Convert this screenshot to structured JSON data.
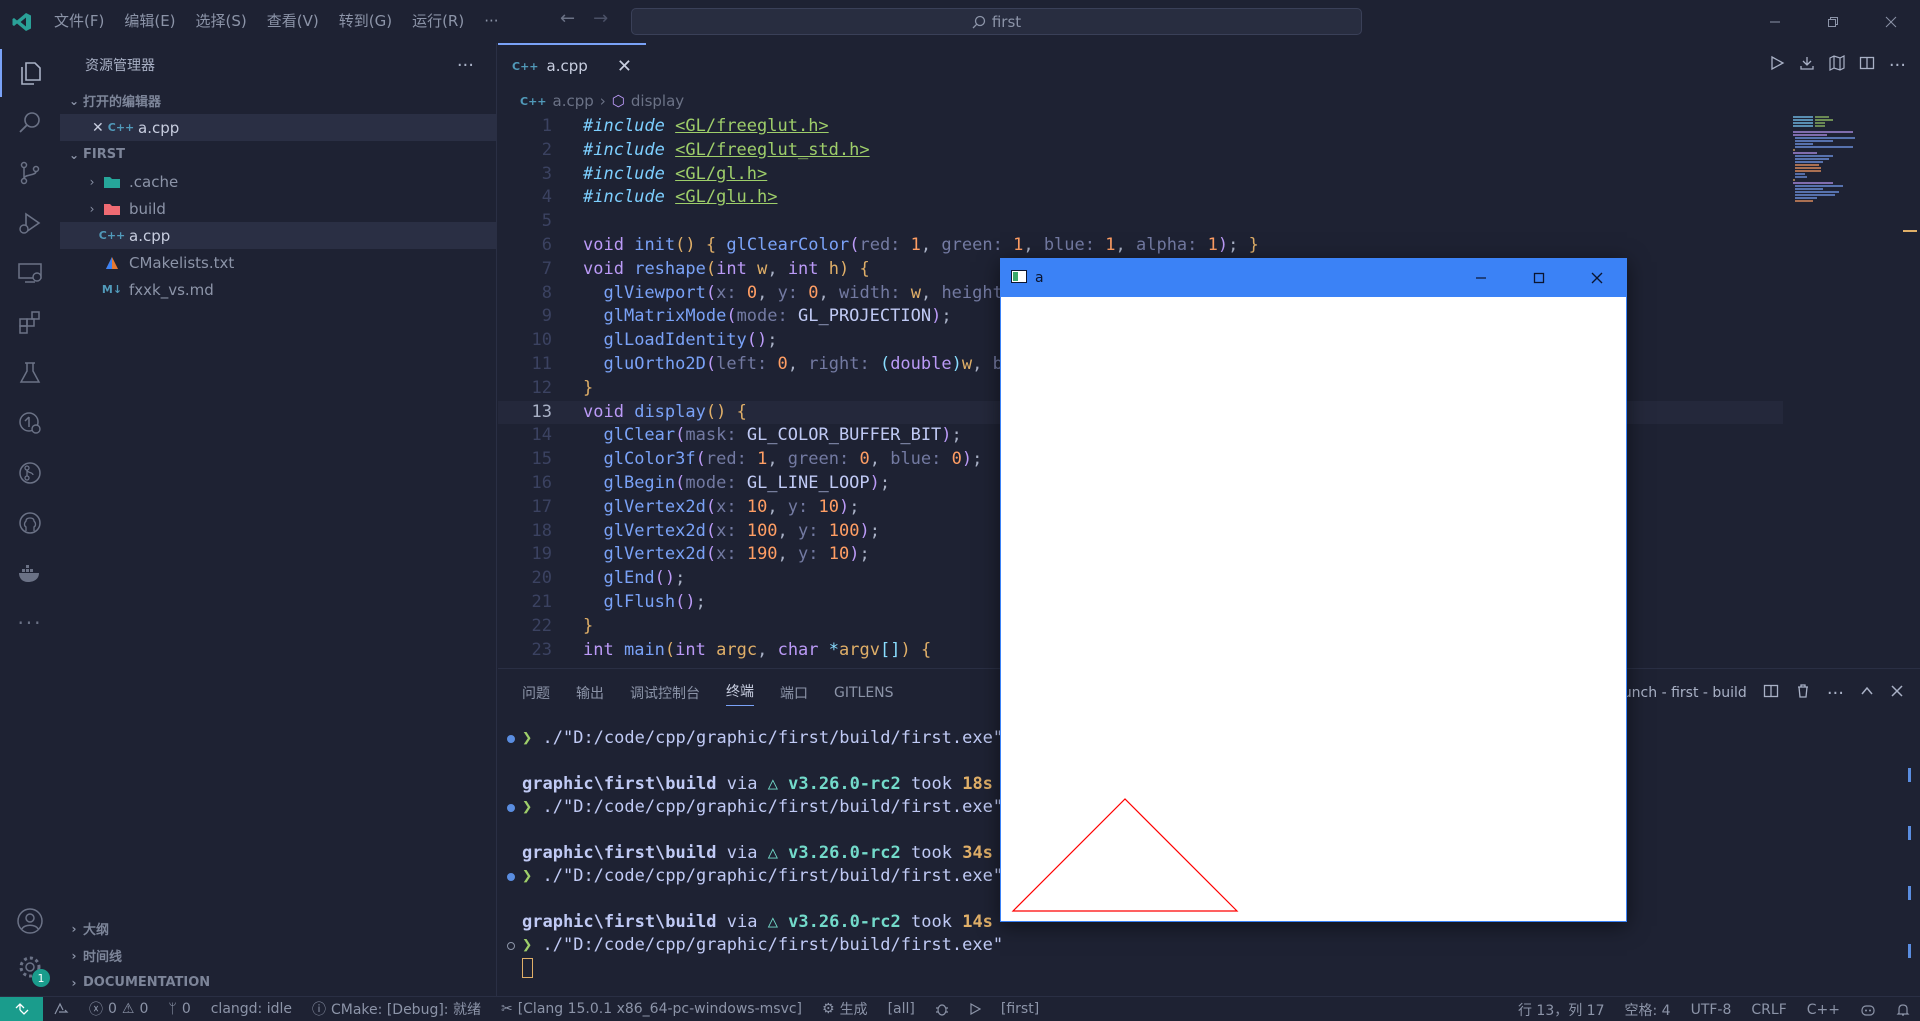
{
  "menus": [
    "文件(F)",
    "编辑(E)",
    "选择(S)",
    "查看(V)",
    "转到(G)",
    "运行(R)",
    "···"
  ],
  "search": {
    "text": "first"
  },
  "sidebar": {
    "title": "资源管理器",
    "open_editors_label": "打开的编辑器",
    "open_editors": [
      {
        "name": "a.cpp"
      }
    ],
    "folder_label": "FIRST",
    "tree": [
      {
        "name": ".cache",
        "type": "folder"
      },
      {
        "name": "build",
        "type": "folder"
      },
      {
        "name": "a.cpp",
        "type": "cpp"
      },
      {
        "name": "CMakelists.txt",
        "type": "cmake"
      },
      {
        "name": "fxxk_vs.md",
        "type": "md"
      }
    ],
    "bottom_sections": [
      "大纲",
      "时间线",
      "DOCUMENTATION"
    ]
  },
  "activity_badge": "1",
  "tab": {
    "label": "a.cpp",
    "icon_text": "C++"
  },
  "breadcrumb": {
    "file": "a.cpp",
    "symbol": "display"
  },
  "code": [
    {
      "n": 1,
      "html": "<span class='kw-inc'>#include</span> <span class='inc-path'>&lt;GL/freeglut.h&gt;</span>"
    },
    {
      "n": 2,
      "html": "<span class='kw-inc'>#include</span> <span class='inc-path'>&lt;GL/freeglut_std.h&gt;</span>"
    },
    {
      "n": 3,
      "html": "<span class='kw-inc'>#include</span> <span class='inc-path'>&lt;GL/gl.h&gt;</span>"
    },
    {
      "n": 4,
      "html": "<span class='kw-inc'>#include</span> <span class='inc-path'>&lt;GL/glu.h&gt;</span>"
    },
    {
      "n": 5,
      "html": ""
    },
    {
      "n": 6,
      "html": "<span class='kw'>void</span> <span class='fn'>init</span><span class='par'>()</span> <span class='par'>{</span> <span class='fn'>glClearColor</span><span class='kw'>(</span><span class='hint'>red:</span> <span class='num'>1</span>, <span class='hint'>green:</span> <span class='num'>1</span>, <span class='hint'>blue:</span> <span class='num'>1</span>, <span class='hint'>alpha:</span> <span class='num'>1</span><span class='kw'>)</span>; <span class='par'>}</span>"
    },
    {
      "n": 7,
      "html": "<span class='kw'>void</span> <span class='fn'>reshape</span><span class='par'>(</span><span class='kw'>int</span> <span class='prm'>w</span>, <span class='kw'>int</span> <span class='prm'>h</span><span class='par'>)</span> <span class='par'>{</span>"
    },
    {
      "n": 8,
      "html": "  <span class='fn'>glViewport</span><span class='kw'>(</span><span class='hint'>x:</span> <span class='num'>0</span>, <span class='hint'>y:</span> <span class='num'>0</span>, <span class='hint'>width:</span> <span class='prm'>w</span>, <span class='hint'>height</span>"
    },
    {
      "n": 9,
      "html": "  <span class='fn'>glMatrixMode</span><span class='kw'>(</span><span class='hint'>mode:</span> <span class='cst'>GL_PROJECTION</span><span class='kw'>)</span>;"
    },
    {
      "n": 10,
      "html": "  <span class='fn'>glLoadIdentity</span><span class='kw'>()</span>;"
    },
    {
      "n": 11,
      "html": "  <span class='fn'>gluOrtho2D</span><span class='kw'>(</span><span class='hint'>left:</span> <span class='num'>0</span>, <span class='hint'>right:</span> <span class='pun'>(</span><span class='kw'>double</span><span class='pun'>)</span><span class='prm'>w</span>, <span class='hint'>b</span>"
    },
    {
      "n": 12,
      "html": "<span class='par'>}</span>"
    },
    {
      "n": 13,
      "html": "<span class='kw'>void</span> <span class='fn'>display</span><span class='par'>()</span> <span class='par'>{</span>",
      "current": true
    },
    {
      "n": 14,
      "html": "  <span class='fn'>glClear</span><span class='kw'>(</span><span class='hint'>mask:</span> <span class='cst'>GL_COLOR_BUFFER_BIT</span><span class='kw'>)</span>;"
    },
    {
      "n": 15,
      "html": "  <span class='fn'>glColor3f</span><span class='kw'>(</span><span class='hint'>red:</span> <span class='num'>1</span>, <span class='hint'>green:</span> <span class='num'>0</span>, <span class='hint'>blue:</span> <span class='num'>0</span><span class='kw'>)</span>;"
    },
    {
      "n": 16,
      "html": "  <span class='fn'>glBegin</span><span class='kw'>(</span><span class='hint'>mode:</span> <span class='cst'>GL_LINE_LOOP</span><span class='kw'>)</span>;"
    },
    {
      "n": 17,
      "html": "  <span class='fn'>glVertex2d</span><span class='kw'>(</span><span class='hint'>x:</span> <span class='num'>10</span>, <span class='hint'>y:</span> <span class='num'>10</span><span class='kw'>)</span>;"
    },
    {
      "n": 18,
      "html": "  <span class='fn'>glVertex2d</span><span class='kw'>(</span><span class='hint'>x:</span> <span class='num'>100</span>, <span class='hint'>y:</span> <span class='num'>100</span><span class='kw'>)</span>;"
    },
    {
      "n": 19,
      "html": "  <span class='fn'>glVertex2d</span><span class='kw'>(</span><span class='hint'>x:</span> <span class='num'>190</span>, <span class='hint'>y:</span> <span class='num'>10</span><span class='kw'>)</span>;"
    },
    {
      "n": 20,
      "html": "  <span class='fn'>glEnd</span><span class='kw'>()</span>;"
    },
    {
      "n": 21,
      "html": "  <span class='fn'>glFlush</span><span class='kw'>()</span>;"
    },
    {
      "n": 22,
      "html": "<span class='par'>}</span>"
    },
    {
      "n": 23,
      "html": "<span class='kw'>int</span> <span class='fn'>main</span><span class='par'>(</span><span class='kw'>int</span> <span class='var'>argc</span>, <span class='kw'>char</span> <span class='pun'>*</span><span class='var'>argv</span><span class='pun'>[]</span><span class='par'>)</span> <span class='par'>{</span>"
    }
  ],
  "panel": {
    "tabs": [
      "问题",
      "输出",
      "调试控制台",
      "终端",
      "端口",
      "GITLENS"
    ],
    "active_tab": "终端",
    "terminal_name": "aunch - first - build"
  },
  "terminal": {
    "command": "./\"D:/code/cpp/graphic/first/build/first.exe\"",
    "prompt_char": "❯",
    "path": "graphic\\first\\build",
    "via": "via",
    "version": "△ v3.26.0-rc2",
    "took_word": "took",
    "durations": [
      "18s",
      "34s",
      "14s"
    ]
  },
  "glwindow": {
    "title": "a",
    "triangle_color": "#ff0000"
  },
  "status": {
    "errors": "0",
    "warnings": "0",
    "ports": "0",
    "clangd": "clangd: idle",
    "cmake": "CMake: [Debug]: 就绪",
    "kit": "[Clang 15.0.1 x86_64-pc-windows-msvc]",
    "build": "生成",
    "target": "[all]",
    "launch_target": "[first]",
    "position": "行 13，列 17",
    "spaces": "空格: 4",
    "encoding": "UTF-8",
    "eol": "CRLF",
    "language": "C++"
  },
  "colors": {
    "accent": "#7aa2f7",
    "remote": "#1a9c8c",
    "glTitle": "#3b82f6"
  }
}
